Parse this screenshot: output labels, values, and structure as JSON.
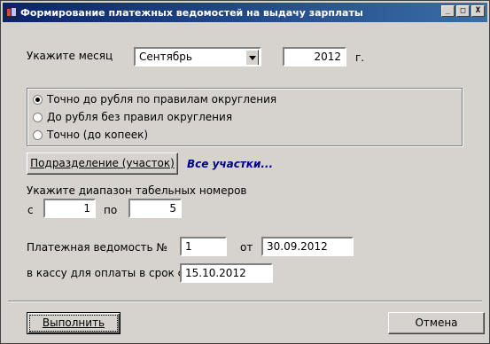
{
  "window": {
    "title": "Формирование платежных ведомостей на выдачу зарплаты",
    "buttons": {
      "minimize": "_",
      "maximize": "□",
      "close": "X"
    }
  },
  "month": {
    "label": "Укажите месяц",
    "selected": "Сентябрь",
    "year": "2012",
    "year_suffix": "г."
  },
  "rounding": {
    "options": [
      {
        "label": "Точно до рубля по правилам округления",
        "checked": true
      },
      {
        "label": "До рубля без правил округления",
        "checked": false
      },
      {
        "label": "Точно (до копеек)",
        "checked": false
      }
    ]
  },
  "department": {
    "button_label": "Подразделение (участок)",
    "value": "Все участки..."
  },
  "tabel_range": {
    "label": "Укажите диапазон табельных номеров",
    "from_label": "с",
    "from_value": "1",
    "to_label": "по",
    "to_value": "5"
  },
  "statement": {
    "number_label": "Платежная ведомость №",
    "number_value": "1",
    "date_label": "от",
    "date_value": "30.09.2012",
    "due_label": "в кассу для оплаты в срок с",
    "due_value": "15.10.2012"
  },
  "footer": {
    "run_label": "Выполнить",
    "cancel_label": "Отмена"
  }
}
